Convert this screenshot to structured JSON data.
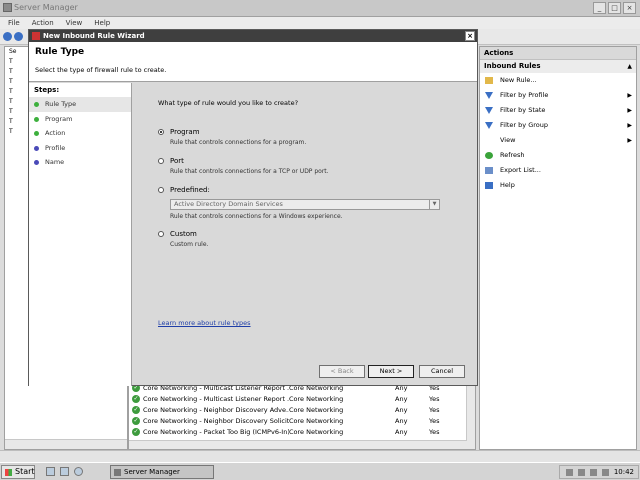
{
  "server_manager": {
    "title": "Server Manager",
    "menu": [
      "File",
      "Action",
      "View",
      "Help"
    ],
    "tree": [
      "Se",
      "T",
      "T",
      "T",
      "T",
      "T",
      "T",
      "T",
      "T"
    ],
    "window_buttons": [
      "_",
      "□",
      "×"
    ]
  },
  "wizard": {
    "title": "New Inbound Rule Wizard",
    "close": "×",
    "header_title": "Rule Type",
    "header_subtitle": "Select the type of firewall rule to create.",
    "steps_label": "Steps:",
    "steps": [
      {
        "label": "Rule Type",
        "color": "#3db03d"
      },
      {
        "label": "Program",
        "color": "#3db03d"
      },
      {
        "label": "Action",
        "color": "#3db03d"
      },
      {
        "label": "Profile",
        "color": "#4a4ab8"
      },
      {
        "label": "Name",
        "color": "#4a4ab8"
      }
    ],
    "question": "What type of rule would you like to create?",
    "options": [
      {
        "label": "Program",
        "desc": "Rule that controls connections for a program.",
        "selected": true
      },
      {
        "label": "Port",
        "desc": "Rule that controls connections for a TCP or UDP port.",
        "selected": false
      },
      {
        "label": "Predefined:",
        "desc": "Rule that controls connections for a Windows experience.",
        "selected": false
      },
      {
        "label": "Custom",
        "desc": "Custom rule.",
        "selected": false
      }
    ],
    "predefined_value": "Active Directory Domain Services",
    "learn_more": "Learn more about rule types",
    "buttons": {
      "back": "< Back",
      "next": "Next >",
      "cancel": "Cancel"
    }
  },
  "actions": {
    "header": "Actions",
    "section": "Inbound Rules",
    "section_arrow": "▲",
    "items": [
      {
        "label": "New Rule...",
        "icon": "new-rule-icon",
        "submenu": false
      },
      {
        "label": "Filter by Profile",
        "icon": "filter-icon",
        "submenu": true
      },
      {
        "label": "Filter by State",
        "icon": "filter-icon",
        "submenu": true
      },
      {
        "label": "Filter by Group",
        "icon": "filter-icon",
        "submenu": true
      },
      {
        "label": "View",
        "icon": "",
        "submenu": true
      },
      {
        "label": "Refresh",
        "icon": "refresh-icon",
        "submenu": false
      },
      {
        "label": "Export List...",
        "icon": "export-icon",
        "submenu": false
      },
      {
        "label": "Help",
        "icon": "help-icon",
        "submenu": false
      }
    ]
  },
  "rules": [
    {
      "name": "Core Networking - Multicast Listener Report ...",
      "group": "Core Networking",
      "profile": "Any",
      "enabled": "Yes"
    },
    {
      "name": "Core Networking - Multicast Listener Report ...",
      "group": "Core Networking",
      "profile": "Any",
      "enabled": "Yes"
    },
    {
      "name": "Core Networking - Neighbor Discovery Adve...",
      "group": "Core Networking",
      "profile": "Any",
      "enabled": "Yes"
    },
    {
      "name": "Core Networking - Neighbor Discovery Solicit...",
      "group": "Core Networking",
      "profile": "Any",
      "enabled": "Yes"
    },
    {
      "name": "Core Networking - Packet Too Big (ICMPv6-In)",
      "group": "Core Networking",
      "profile": "Any",
      "enabled": "Yes"
    }
  ],
  "taskbar": {
    "start": "Start",
    "task": "Server Manager",
    "clock": "10:42"
  }
}
